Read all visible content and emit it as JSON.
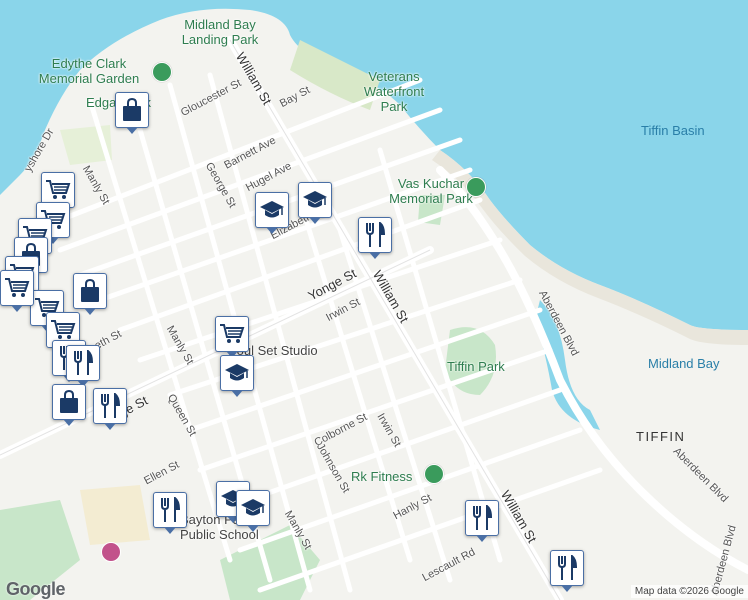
{
  "map": {
    "attribution": "Map data ©2026 Google",
    "logo_text": "Google",
    "colors": {
      "water": "#8ad5ea",
      "land": "#f3f3ef",
      "park": "#c8e6c9",
      "road": "#ffffff",
      "marker_border": "#4a6fa5",
      "marker_icon": "#1b3a66"
    }
  },
  "water_labels": {
    "tiffin_basin": "Tiffin Basin",
    "midland_bay": "Midland Bay"
  },
  "area_labels": {
    "tiffin": "TIFFIN"
  },
  "parks": {
    "midland_bay_landing_park": "Midland Bay Landing Park",
    "edythe_clark_memorial_garden": "Edythe Clark Memorial Garden",
    "edgar_park": "Edgar Park",
    "veterans_waterfront_park": "Veterans Waterfront Park",
    "vas_kuchar_memorial_park": "Vas Kuchar Memorial Park",
    "tiffin_park": "Tiffin Park"
  },
  "places": {
    "soul_set_studio": "Soul Set Studio",
    "rk_fitness": "Rk Fitness",
    "school_line1": "Bayton Park",
    "school_line2": "Public School"
  },
  "streets": {
    "william_st_north": "William St",
    "william_st_mid": "William St",
    "william_st_south": "William St",
    "gloucester_st": "Gloucester St",
    "bay_st": "Bay St",
    "barnett_ave": "Barnett Ave",
    "george_st": "George St",
    "hugel_ave": "Hugel Ave",
    "elizabeth_st": "Elizabeth",
    "elizabeth_st_west": "eth St",
    "bayshore_dr": "yshore Dr",
    "manly_st_north": "Manly St",
    "manly_st_mid": "Manly St",
    "manly_st_south": "Manly St",
    "yonge_st_east": "Yonge St",
    "yonge_st_west": "ge St",
    "irwin_st_north": "Irwin St",
    "irwin_st_south": "Irwin St",
    "queen_st": "Queen St",
    "colborne_st": "Colborne St",
    "johnson_st": "Johnson St",
    "ellen_st": "Ellen St",
    "hanly_st": "Hanly St",
    "lescault_rd": "Lescault Rd",
    "aberdeen_blvd_north": "Aberdeen Blvd",
    "aberdeen_blvd_south": "Aberdeen Blvd",
    "aberdeen_blvd_far": "Aberdeen Blvd"
  },
  "markers": [
    {
      "icon": "shopping-bag-icon"
    },
    {
      "icon": "shopping-cart-icon"
    },
    {
      "icon": "shopping-cart-icon"
    },
    {
      "icon": "shopping-cart-icon"
    },
    {
      "icon": "shopping-bag-icon"
    },
    {
      "icon": "shopping-bag-icon"
    },
    {
      "icon": "shopping-cart-icon"
    },
    {
      "icon": "shopping-cart-icon"
    },
    {
      "icon": "shopping-cart-icon"
    },
    {
      "icon": "restaurant-icon"
    },
    {
      "icon": "restaurant-icon"
    },
    {
      "icon": "restaurant-icon"
    },
    {
      "icon": "shopping-bag-icon"
    },
    {
      "icon": "restaurant-icon"
    },
    {
      "icon": "school-icon"
    },
    {
      "icon": "school-icon"
    },
    {
      "icon": "restaurant-icon"
    },
    {
      "icon": "shopping-cart-icon"
    },
    {
      "icon": "school-icon"
    },
    {
      "icon": "restaurant-icon"
    },
    {
      "icon": "school-icon"
    },
    {
      "icon": "school-icon"
    },
    {
      "icon": "restaurant-icon"
    },
    {
      "icon": "shopping-cart-icon"
    }
  ]
}
